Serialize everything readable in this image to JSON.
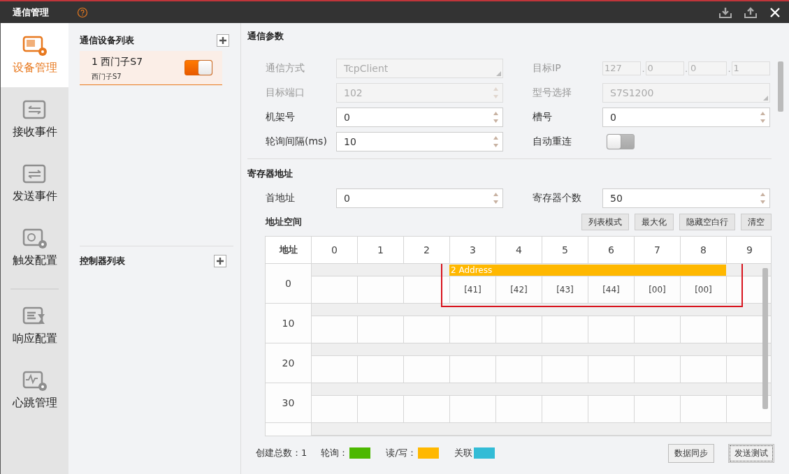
{
  "window": {
    "title": "通信管理"
  },
  "nav_groups": [
    [
      {
        "label": "设备管理",
        "selected": true
      },
      {
        "label": "接收事件",
        "selected": false
      },
      {
        "label": "发送事件",
        "selected": false
      },
      {
        "label": "触发配置",
        "selected": false
      }
    ],
    [
      {
        "label": "响应配置",
        "selected": false
      },
      {
        "label": "心跳管理",
        "selected": false
      }
    ]
  ],
  "device_list": {
    "title": "通信设备列表",
    "devices": [
      {
        "name": "1 西门子S7",
        "subtitle": "西门子S7",
        "on": true,
        "selected": true
      }
    ]
  },
  "controller_list": {
    "title": "控制器列表"
  },
  "params": {
    "title": "通信参数",
    "fields": [
      {
        "label": "通信方式",
        "kind": "combo",
        "value": "TcpClient",
        "disabled": true
      },
      {
        "label": "目标IP",
        "kind": "ip",
        "parts": [
          "127",
          "0",
          "0",
          "1"
        ],
        "separator": ".",
        "disabled": true
      },
      {
        "label": "目标端口",
        "kind": "spin",
        "value": "102",
        "disabled": true
      },
      {
        "label": "型号选择",
        "kind": "combo",
        "value": "S7S1200",
        "disabled": true
      },
      {
        "label": "机架号",
        "kind": "spin",
        "value": "0",
        "disabled": false
      },
      {
        "label": "槽号",
        "kind": "spin",
        "value": "0",
        "disabled": false
      },
      {
        "label": "轮询间隔(ms)",
        "kind": "spin",
        "value": "10",
        "disabled": false
      },
      {
        "label": "自动重连",
        "kind": "toggle",
        "on": false
      }
    ]
  },
  "register": {
    "title": "寄存器地址",
    "fields": [
      {
        "label": "首地址",
        "kind": "spin",
        "value": "0",
        "disabled": false
      },
      {
        "label": "寄存器个数",
        "kind": "spin",
        "value": "50",
        "disabled": false
      }
    ],
    "space": {
      "title": "地址空间",
      "buttons": [
        "列表模式",
        "最大化",
        "隐藏空白行",
        "清空"
      ],
      "columns": [
        "地址",
        "0",
        "1",
        "2",
        "3",
        "4",
        "5",
        "6",
        "7",
        "8",
        "9"
      ],
      "rows": [
        {
          "label": "0",
          "highlighted": true,
          "field_label": "2 Address",
          "cells": [
            null,
            null,
            null,
            "[41]",
            "[42]",
            "[43]",
            "[44]",
            "[00]",
            "[00]",
            null
          ]
        },
        {
          "label": "10",
          "highlighted": false
        },
        {
          "label": "20",
          "highlighted": false
        },
        {
          "label": "30",
          "highlighted": false
        },
        {
          "highlighted": false
        }
      ]
    }
  },
  "footer": {
    "total": "创建总数：1",
    "legend": [
      {
        "label": "轮询：",
        "color": "#4cb800"
      },
      {
        "label": "读/写：",
        "color": "#ffb800"
      },
      {
        "label": "关联",
        "color": "#33bcd6"
      }
    ],
    "buttons": [
      {
        "label": "数据同步",
        "focused": false
      },
      {
        "label": "发送测试",
        "focused": true
      }
    ]
  }
}
